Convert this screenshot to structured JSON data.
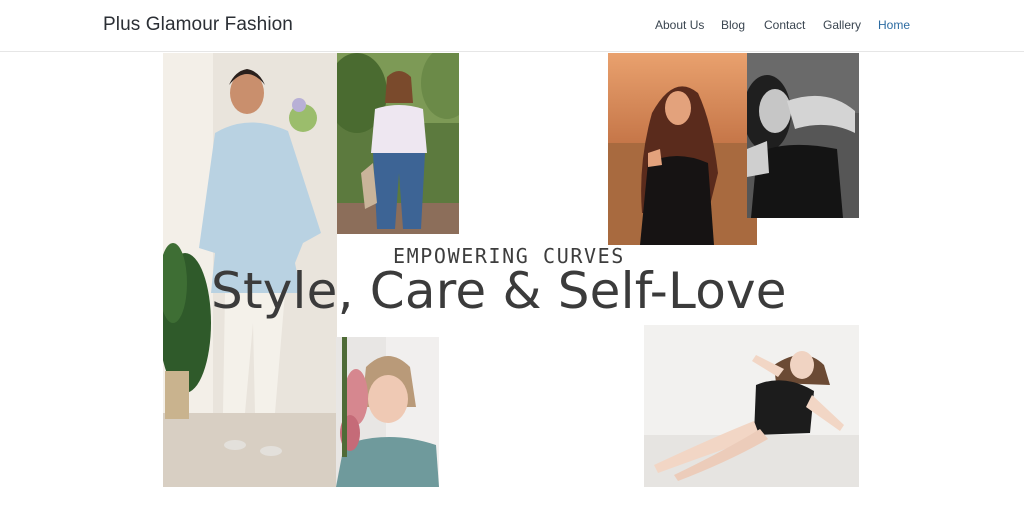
{
  "header": {
    "site_title": "Plus Glamour Fashion",
    "nav": [
      {
        "label": "About Us",
        "active": false
      },
      {
        "label": "Blog",
        "active": false
      },
      {
        "label": "Contact",
        "active": false
      },
      {
        "label": "Gallery",
        "active": false
      },
      {
        "label": "Home",
        "active": true
      }
    ],
    "active_color": "#2d6ca2"
  },
  "hero": {
    "eyebrow": "EMPOWERING CURVES",
    "headline": "Style, Care & Self-Love"
  },
  "gallery": [
    {
      "name": "woman-light-blue-tunic-with-flowers-photo"
    },
    {
      "name": "woman-white-tee-jeans-outdoors-photo"
    },
    {
      "name": "woman-black-dress-sunset-field-photo"
    },
    {
      "name": "woman-black-white-portrait-photo"
    },
    {
      "name": "woman-with-pink-flowers-photo"
    },
    {
      "name": "woman-black-swimsuit-reclining-photo"
    }
  ]
}
